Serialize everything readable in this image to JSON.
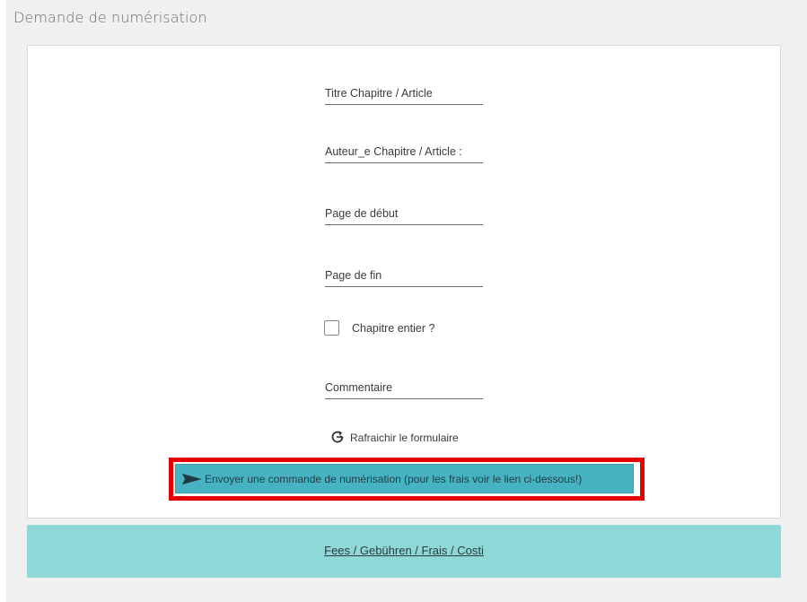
{
  "section": {
    "title": "Demande de numérisation"
  },
  "form": {
    "fields": [
      {
        "label": "Titre Chapitre / Article",
        "value": ""
      },
      {
        "label": "Auteur_e Chapitre / Article :",
        "value": ""
      },
      {
        "label": "Page de début",
        "value": ""
      },
      {
        "label": "Page de fin",
        "value": ""
      },
      {
        "label": "Commentaire",
        "value": ""
      }
    ],
    "checkbox": {
      "label": "Chapitre entier ?",
      "checked": false
    },
    "refresh": {
      "label": "Rafraichir le formulaire",
      "icon": "refresh-icon"
    },
    "submit": {
      "label": "Envoyer une commande de numérisation (pour les frais voir le lien ci-dessous!)",
      "icon": "send-icon",
      "color": "#47b3c2",
      "highlight_color": "#e60000"
    }
  },
  "fees": {
    "link_label": "Fees / Gebühren / Frais / Costi",
    "color": "#8fd8d8"
  }
}
